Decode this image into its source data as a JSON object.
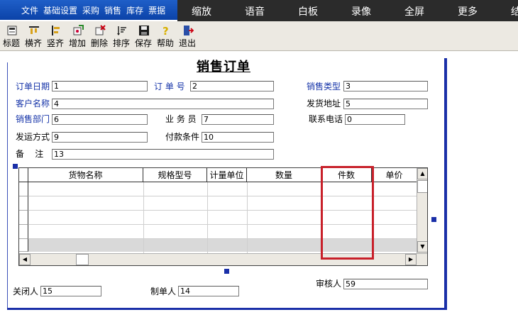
{
  "menubar": {
    "items": [
      "文件",
      "基础设置",
      "采购",
      "销售",
      "库存",
      "票据"
    ]
  },
  "overlay": {
    "items": [
      "缩放",
      "语音",
      "白板",
      "录像",
      "全屏",
      "更多",
      "结"
    ]
  },
  "toolbar": {
    "buttons": [
      {
        "label": "标题",
        "icon": "title-icon"
      },
      {
        "label": "横齐",
        "icon": "align-horizontal-icon"
      },
      {
        "label": "竖齐",
        "icon": "align-vertical-icon"
      },
      {
        "label": "增加",
        "icon": "add-icon"
      },
      {
        "label": "删除",
        "icon": "delete-icon"
      },
      {
        "label": "排序",
        "icon": "sort-icon"
      },
      {
        "label": "保存",
        "icon": "save-icon"
      },
      {
        "label": "帮助",
        "icon": "help-icon"
      },
      {
        "label": "退出",
        "icon": "exit-icon"
      }
    ]
  },
  "form": {
    "title": "销售订单",
    "order_date": {
      "label": "订单日期",
      "value": "1"
    },
    "order_no": {
      "label": "订 单 号",
      "value": "2"
    },
    "sales_type": {
      "label": "销售类型",
      "value": "3"
    },
    "customer": {
      "label": "客户名称",
      "value": "4"
    },
    "ship_address": {
      "label": "发货地址",
      "value": "5"
    },
    "sales_dept": {
      "label": "销售部门",
      "value": "6"
    },
    "salesperson": {
      "label": "业 务 员",
      "value": "7"
    },
    "phone": {
      "label": "联系电话",
      "value": "0"
    },
    "ship_method": {
      "label": "发运方式",
      "value": "9"
    },
    "payment_terms": {
      "label": "付款条件",
      "value": "10"
    },
    "remark": {
      "label": "备    注",
      "value": "13"
    },
    "closer": {
      "label": "关闭人",
      "value": "15"
    },
    "creator": {
      "label": "制单人",
      "value": "14"
    },
    "reviewer": {
      "label": "审核人",
      "value": "59"
    }
  },
  "grid": {
    "columns": [
      "货物名称",
      "规格型号",
      "计量单位",
      "数量",
      "件数",
      "单价"
    ]
  },
  "colors": {
    "accent": "#1a2fa8",
    "highlight_box": "#c8202a",
    "menubar": "#0b43a8"
  }
}
